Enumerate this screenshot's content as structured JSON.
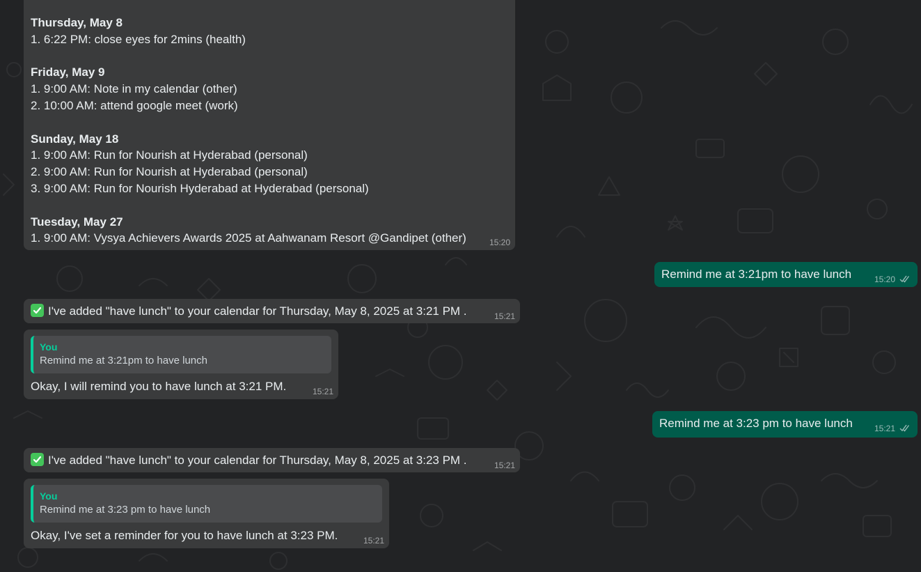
{
  "colors": {
    "background": "#222325",
    "incoming_bubble": "#3a3b3c",
    "outgoing_bubble": "#005c4b",
    "quote_accent": "#06cf9c",
    "check_emoji": "#44c45a"
  },
  "schedule_message": {
    "days": [
      {
        "title": "Thursday, May 8",
        "items": [
          "1. 6:22 PM: close eyes for 2mins (health)"
        ]
      },
      {
        "title": "Friday, May 9",
        "items": [
          "1. 9:00 AM: Note in my calendar (other)",
          "2. 10:00 AM: attend google meet (work)"
        ]
      },
      {
        "title": "Sunday, May 18",
        "items": [
          "1. 9:00 AM: Run for Nourish at Hyderabad (personal)",
          "2. 9:00 AM: Run for Nourish at Hyderabad (personal)",
          "3. 9:00 AM: Run for Nourish Hyderabad at Hyderabad (personal)"
        ]
      },
      {
        "title": "Tuesday, May 27",
        "items": [
          "1. 9:00 AM: Vysya Achievers Awards 2025 at Aahwanam Resort @Gandipet (other)"
        ]
      }
    ],
    "time": "15:20"
  },
  "messages": [
    {
      "text": "Remind me at 3:21pm to have lunch",
      "time": "15:20"
    },
    {
      "text": "I've added \"have lunch\" to your calendar for Thursday, May 8, 2025 at 3:21 PM .",
      "time": "15:21"
    },
    {
      "quote_author": "You",
      "quote_text": "Remind me at 3:21pm to have lunch",
      "text": "Okay, I will remind you to have lunch at 3:21 PM.",
      "time": "15:21"
    },
    {
      "text": "Remind me at 3:23 pm to have lunch",
      "time": "15:21"
    },
    {
      "text": "I've added \"have lunch\" to your calendar for Thursday, May 8, 2025 at 3:23 PM .",
      "time": "15:21"
    },
    {
      "quote_author": "You",
      "quote_text": "Remind me at 3:23 pm to have lunch",
      "text": "Okay, I've set a reminder for you to have lunch at 3:23 PM.",
      "time": "15:21"
    }
  ],
  "icons": {
    "check": "check-mark-button-icon",
    "read_receipt": "double-check-icon"
  }
}
